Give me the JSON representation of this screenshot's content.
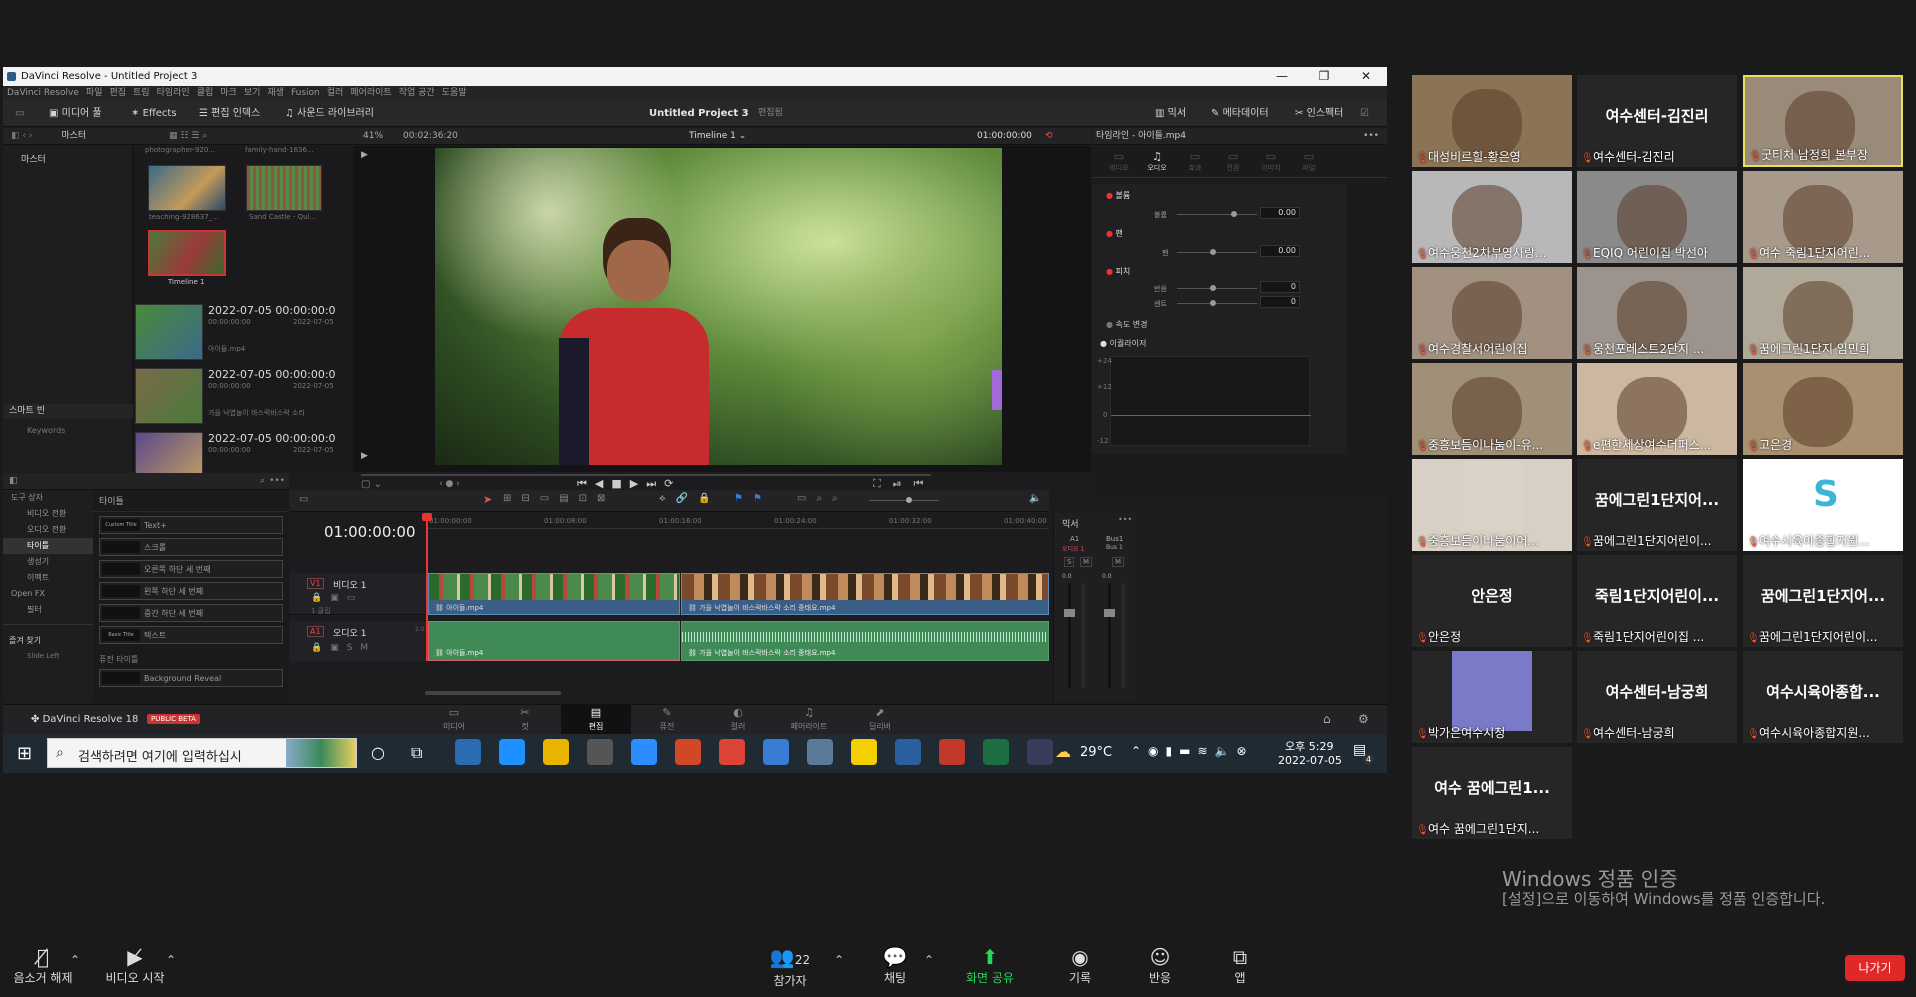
{
  "window": {
    "title": "DaVinci Resolve - Untitled Project 3"
  },
  "menu": [
    "DaVinci Resolve",
    "파일",
    "편집",
    "트림",
    "타임라인",
    "클립",
    "마크",
    "보기",
    "재생",
    "Fusion",
    "컬러",
    "페어라이트",
    "작업 공간",
    "도움말"
  ],
  "toolbar": {
    "media_pool": "미디어 풀",
    "effects": "Effects",
    "edit_index": "편집 인덱스",
    "sound_library": "사운드 라이브러리",
    "project_title": "Untitled Project 3",
    "edited_status": "편집됨",
    "mixer": "믹서",
    "metadata": "메타데이터",
    "inspector": "인스펙터"
  },
  "media_pool": {
    "label": "마스터",
    "bin": "마스터",
    "smart_bin": "스마트 빈",
    "keywords": "Keywords",
    "grid_captions_top": [
      "photographer-920...",
      "family-hand-1636..."
    ],
    "grid_items": [
      {
        "label": "teaching-928637_..."
      },
      {
        "label": "Sand Castle - Qui..."
      },
      {
        "label": "Timeline 1"
      }
    ],
    "list_items": [
      {
        "date": "2022-07-05  00:00:00:0",
        "tc": "00:00:00:00",
        "date2": "2022-07-05",
        "name": "아이들.mp4"
      },
      {
        "date": "2022-07-05  00:00:00:0",
        "tc": "00:00:00:00",
        "date2": "2022-07-05",
        "name": "가을 낙엽놀이 바스락바스락 소리"
      },
      {
        "date": "2022-07-05  00:00:00:0",
        "tc": "00:00:00:00",
        "date2": "2022-07-05",
        "name": ""
      }
    ]
  },
  "viewer": {
    "zoom": "41%",
    "duration": "00:02:36:20",
    "timeline_name": "Timeline 1",
    "timecode": "01:00:00:00"
  },
  "inspector_panel": {
    "header": "타임라인 - 아이들.mp4",
    "tabs": [
      "비디오",
      "오디오",
      "효과",
      "전환",
      "이미지",
      "파일"
    ],
    "active_tab": "오디오",
    "volume": {
      "label": "볼륨",
      "sub": "볼륨",
      "value": "0.00"
    },
    "pan": {
      "label": "팬",
      "sub": "팬",
      "value": "0.00"
    },
    "pitch": {
      "label": "피치",
      "semitones_label": "반음",
      "cents_label": "센트",
      "semitones": "0",
      "cents": "0"
    },
    "speed": "속도 변경",
    "eq": "이퀄라이저",
    "eq_ticks": [
      "+24",
      "+12",
      "0",
      "-12"
    ]
  },
  "effects_library": {
    "tree": [
      "도구 상자",
      "비디오 전환",
      "오디오 전환",
      "타이틀",
      "생성기",
      "이펙트",
      "Open FX",
      "필터"
    ],
    "favorites": "즐겨 찾기",
    "favorite_item": "Slide Left",
    "section_titles": "타이틀",
    "titles": [
      {
        "thumb": "Custom Title",
        "name": "Text+"
      },
      {
        "thumb": "",
        "name": "스크롤"
      },
      {
        "thumb": "",
        "name": "오른쪽 하단 세 번째"
      },
      {
        "thumb": "",
        "name": "왼쪽 하단 세 번째"
      },
      {
        "thumb": "",
        "name": "중간 하단 세 번째"
      },
      {
        "thumb": "Basic Title",
        "name": "텍스트"
      }
    ],
    "section_fusion": "퓨전 타이틀",
    "fusion_item": "Background Reveal"
  },
  "timeline": {
    "timecode": "01:00:00:00",
    "ruler": [
      "01:00:00:00",
      "01:00:08:00",
      "01:00:16:00",
      "01:00:24:00",
      "01:00:32:00",
      "01:00:40:00"
    ],
    "v1": {
      "tag": "V1",
      "name": "비디오 1",
      "clips": "1 클립"
    },
    "a1": {
      "tag": "A1",
      "name": "오디오 1",
      "ch": "2.0"
    },
    "clip1": "아이들.mp4",
    "clip2": "가을 낙엽놀이 바스락바스락 소리 중태요.mp4",
    "mixer": {
      "title": "믹서",
      "a1": "A1",
      "bus1": "Bus1",
      "audio1": "오디오 1",
      "bus1b": "Bus 1",
      "s": "S",
      "m": "M",
      "val1": "0.0",
      "val2": "0.0"
    }
  },
  "pages": [
    "미디어",
    "컷",
    "편집",
    "퓨전",
    "컬러",
    "페어라이트",
    "딜리버"
  ],
  "active_page": "편집",
  "brand": {
    "name": "DaVinci Resolve 18",
    "badge": "PUBLIC BETA"
  },
  "taskbar": {
    "search_placeholder": "검색하려면 여기에 입력하십시",
    "weather": "29°C",
    "time": "오후 5:29",
    "date": "2022-07-05",
    "notif": "4"
  },
  "zoom": {
    "participants": [
      {
        "name": "대성비르힐-황은영",
        "display": "",
        "video": true,
        "bg": "#8b7355"
      },
      {
        "name": "여수센터-김진리",
        "display": "여수센터-김진리",
        "video": false
      },
      {
        "name": "굿티처 남정희 본부장",
        "display": "",
        "video": true,
        "bg": "#9a8a7a",
        "active": true
      },
      {
        "name": "여수웅천2차부영사랑...",
        "display": "",
        "video": true,
        "bg": "#b8b8b8"
      },
      {
        "name": "EQIQ 어린이집 박선아",
        "display": "",
        "video": true,
        "bg": "#8a8a8a"
      },
      {
        "name": "여수 죽림1단지어린...",
        "display": "",
        "video": true,
        "bg": "#a89a8a"
      },
      {
        "name": "여수경찰서어린이집",
        "display": "",
        "video": true,
        "bg": "#a29080"
      },
      {
        "name": "웅천포레스트2단지 ...",
        "display": "",
        "video": true,
        "bg": "#9c948c"
      },
      {
        "name": "꿈에그린1단지 임민희",
        "display": "",
        "video": true,
        "bg": "#b0a898"
      },
      {
        "name": "중흥보듬이나눔이-유...",
        "display": "",
        "video": true,
        "bg": "#a09078"
      },
      {
        "name": "e편한세상여수더퍼스...",
        "display": "",
        "video": true,
        "bg": "#ccb8a0"
      },
      {
        "name": "고은경",
        "display": "",
        "video": true,
        "bg": "#a89070"
      },
      {
        "name": "중흥보듬이나눔이어...",
        "display": "",
        "video": true,
        "bg": "#d8d0c4",
        "small": true
      },
      {
        "name": "꿈에그린1단지어린이...",
        "display": "꿈에그린1단지어...",
        "video": false
      },
      {
        "name": "여수시육아종합지원...",
        "display": "",
        "video": true,
        "bg": "#ffffff",
        "logo": true
      },
      {
        "name": "안은정",
        "display": "안은정",
        "video": false
      },
      {
        "name": "죽림1단지어린이집 ...",
        "display": "죽림1단지어린이...",
        "video": false
      },
      {
        "name": "꿈에그린1단지어린이...",
        "display": "꿈에그린1단지어...",
        "video": false
      },
      {
        "name": "박가은여수시청",
        "display": "",
        "video": false,
        "avatar": true
      },
      {
        "name": "여수센터-남궁희",
        "display": "여수센터-남궁희",
        "video": false
      },
      {
        "name": "여수시육아종합지원...",
        "display": "여수시육아종합...",
        "video": false
      },
      {
        "name": "여수 꿈에그린1단지...",
        "display": "여수 꿈에그린1...",
        "video": false
      }
    ],
    "watermark_title": "Windows 정품 인증",
    "watermark_sub": "[설정]으로 이동하여 Windows를 정품 인증합니다.",
    "bottom": {
      "unmute": "음소거 해제",
      "start_video": "비디오 시작",
      "participants": "참가자",
      "participant_count": "22",
      "chat": "채팅",
      "share": "화면 공유",
      "record": "기록",
      "reactions": "반응",
      "apps": "앱",
      "leave": "나가기"
    },
    "colors": {
      "share": "#23d959",
      "leave": "#e02828",
      "active_border": "#e8e05a"
    }
  }
}
